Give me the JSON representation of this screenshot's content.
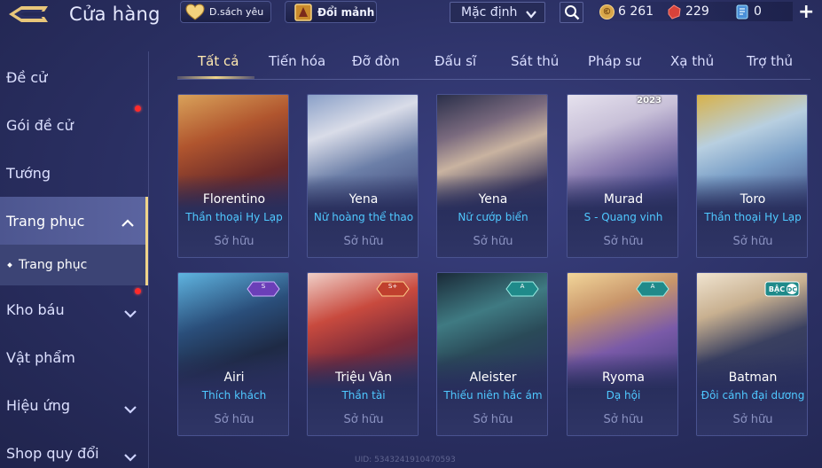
{
  "header": {
    "title": "Cửa hàng",
    "wishlist_label": "D.sách yêu",
    "fragment_label": "Đổi mảnh",
    "sort_value": "Mặc định",
    "currencies": [
      {
        "icon": "gold-coin-icon",
        "value": "6 261",
        "color": "#d9a74a"
      },
      {
        "icon": "ruby-icon",
        "value": "229",
        "color": "#d8423a"
      },
      {
        "icon": "voucher-icon",
        "value": "0",
        "color": "#7fd3ff"
      }
    ],
    "plus_label": "+"
  },
  "sidebar": {
    "items": [
      {
        "label": "Đề cử"
      },
      {
        "label": "Gói đề cử"
      },
      {
        "label": "Tướng"
      },
      {
        "label": "Trang phục"
      },
      {
        "label": "Kho báu"
      },
      {
        "label": "Vật phẩm"
      },
      {
        "label": "Hiệu ứng"
      },
      {
        "label": "Shop quy đổi"
      }
    ],
    "sub_item": "Trang phục"
  },
  "tabs": [
    "Tất cả",
    "Tiến hóa",
    "Đỡ đòn",
    "Đấu sĩ",
    "Sát thủ",
    "Pháp sư",
    "Xạ thủ",
    "Trợ thủ"
  ],
  "cards": [
    {
      "name": "Florentino",
      "skin": "Thần thoại Hy Lạp",
      "status": "Sở hữu",
      "tier": "",
      "year": ""
    },
    {
      "name": "Yena",
      "skin": "Nữ hoàng thể thao",
      "status": "Sở hữu",
      "tier": "",
      "year": ""
    },
    {
      "name": "Yena",
      "skin": "Nữ cướp biển",
      "status": "Sở hữu",
      "tier": "",
      "year": ""
    },
    {
      "name": "Murad",
      "skin": "S - Quang vinh",
      "status": "Sở hữu",
      "tier": "",
      "year": "2023"
    },
    {
      "name": "Toro",
      "skin": "Thần thoại Hy Lạp",
      "status": "Sở hữu",
      "tier": "",
      "year": ""
    },
    {
      "name": "Airi",
      "skin": "Thích khách",
      "status": "Sở hữu",
      "tier": "S",
      "year": ""
    },
    {
      "name": "Triệu Vân",
      "skin": "Thần tài",
      "status": "Sở hữu",
      "tier": "S+",
      "year": ""
    },
    {
      "name": "Aleister",
      "skin": "Thiếu niên hắc ám",
      "status": "Sở hữu",
      "tier": "A",
      "year": ""
    },
    {
      "name": "Ryoma",
      "skin": "Dạ hội",
      "status": "Sở hữu",
      "tier": "A",
      "year": ""
    },
    {
      "name": "Batman",
      "skin": "Đôi cánh đại dương",
      "status": "Sở hữu",
      "tier": "BẬC",
      "year": ""
    }
  ],
  "uid": "UID: 5343241910470593"
}
